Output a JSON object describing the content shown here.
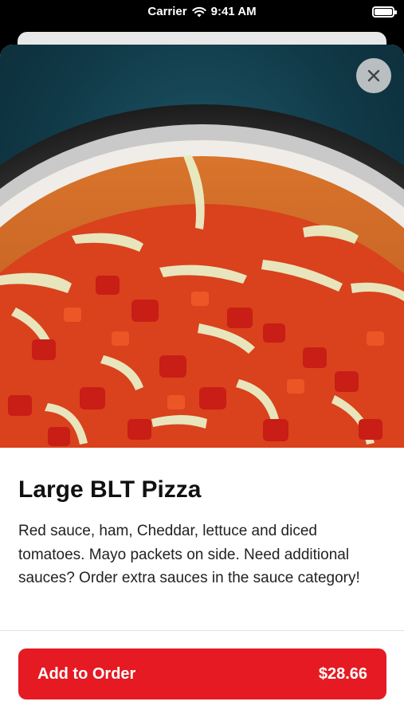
{
  "status_bar": {
    "carrier": "Carrier",
    "time": "9:41 AM"
  },
  "item": {
    "name": "Large BLT Pizza",
    "description": "Red sauce, ham, Cheddar, lettuce and diced tomatoes. Mayo packets on side. Need additional sauces? Order extra sauces in the sauce category!"
  },
  "actions": {
    "add_to_order_label": "Add to Order",
    "price": "$28.66"
  },
  "icons": {
    "close": "close-icon",
    "wifi": "wifi-icon",
    "battery": "battery-icon"
  },
  "colors": {
    "accent": "#e51a22"
  }
}
